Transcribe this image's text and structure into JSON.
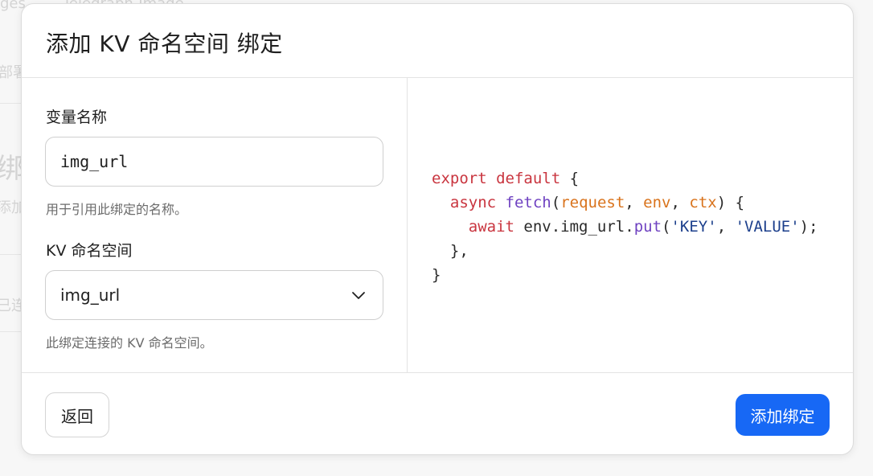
{
  "background": {
    "fragments": [
      "ges",
      "Telegraph-Image",
      "部署",
      "绑",
      "添加",
      "已连"
    ]
  },
  "modal": {
    "title": "添加 KV 命名空间 绑定",
    "variable": {
      "label": "变量名称",
      "value": "img_url",
      "help": "用于引用此绑定的名称。"
    },
    "namespace": {
      "label": "KV 命名空间",
      "selected": "img_url",
      "help": "此绑定连接的 KV 命名空间。"
    },
    "code": {
      "binding": "img_url",
      "key": "'KEY'",
      "value": "'VALUE'"
    },
    "footer": {
      "back_label": "返回",
      "submit_label": "添加绑定"
    }
  },
  "colors": {
    "primary": "#1768f5",
    "keyword": "#c9353f",
    "function": "#6f42c1",
    "parameter": "#d9731c",
    "string": "#1c3f8c"
  }
}
